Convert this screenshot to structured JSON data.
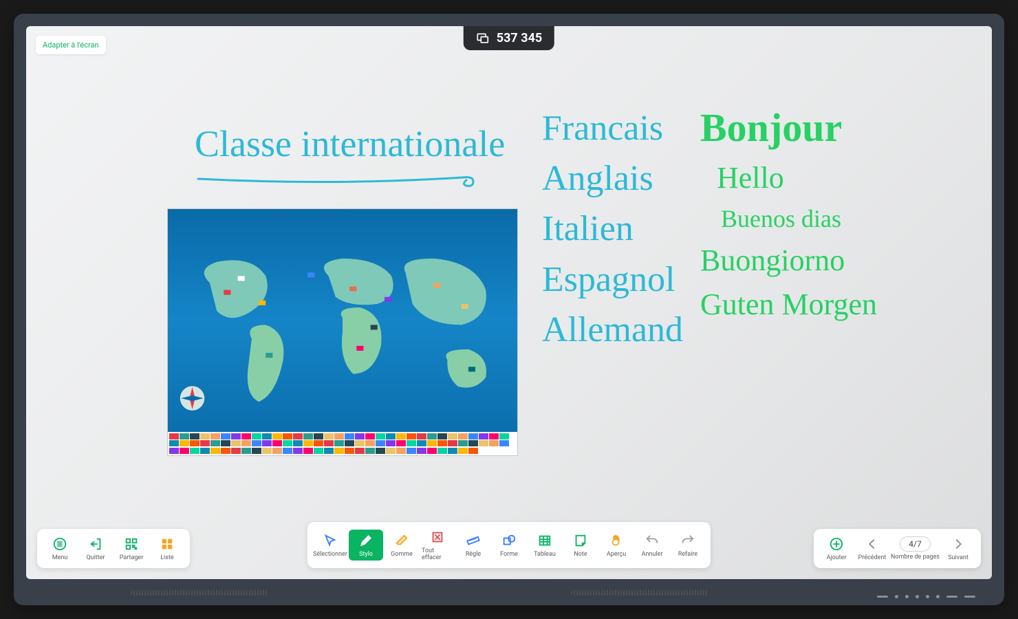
{
  "colors": {
    "accent": "#0ab463",
    "ink_blue": "#2cb9d6",
    "ink_green": "#27d164"
  },
  "header": {
    "fit_button": "Adapter à l'écran",
    "session_code": "537 345"
  },
  "board": {
    "title": "Classe internationale",
    "languages": [
      "Francais",
      "Anglais",
      "Italien",
      "Espagnol",
      "Allemand"
    ],
    "greetings": [
      "Bonjour",
      "Hello",
      "Buenos dias",
      "Buongiorno",
      "Guten Morgen"
    ]
  },
  "toolbars": {
    "left": [
      {
        "id": "menu",
        "label": "Menu",
        "icon": "menu"
      },
      {
        "id": "quit",
        "label": "Quitter",
        "icon": "exit"
      },
      {
        "id": "share",
        "label": "Partager",
        "icon": "qr"
      },
      {
        "id": "list",
        "label": "Liste",
        "icon": "grid"
      }
    ],
    "center": [
      {
        "id": "select",
        "label": "Sélectionner",
        "icon": "cursor"
      },
      {
        "id": "pen",
        "label": "Stylo",
        "icon": "pen",
        "active": true
      },
      {
        "id": "eraser",
        "label": "Gomme",
        "icon": "eraser"
      },
      {
        "id": "clear",
        "label": "Tout effacer",
        "icon": "clear"
      },
      {
        "id": "ruler",
        "label": "Règle",
        "icon": "ruler"
      },
      {
        "id": "shape",
        "label": "Forme",
        "icon": "shape"
      },
      {
        "id": "table",
        "label": "Tableau",
        "icon": "table"
      },
      {
        "id": "note",
        "label": "Note",
        "icon": "note"
      },
      {
        "id": "preview",
        "label": "Aperçu",
        "icon": "hand"
      },
      {
        "id": "undo",
        "label": "Annuler",
        "icon": "undo"
      },
      {
        "id": "redo",
        "label": "Refaire",
        "icon": "redo"
      }
    ],
    "right": {
      "add": "Ajouter",
      "prev": "Précédent",
      "pages_label": "Nombre de pages",
      "pages_value": "4/7",
      "next": "Suivant"
    }
  }
}
